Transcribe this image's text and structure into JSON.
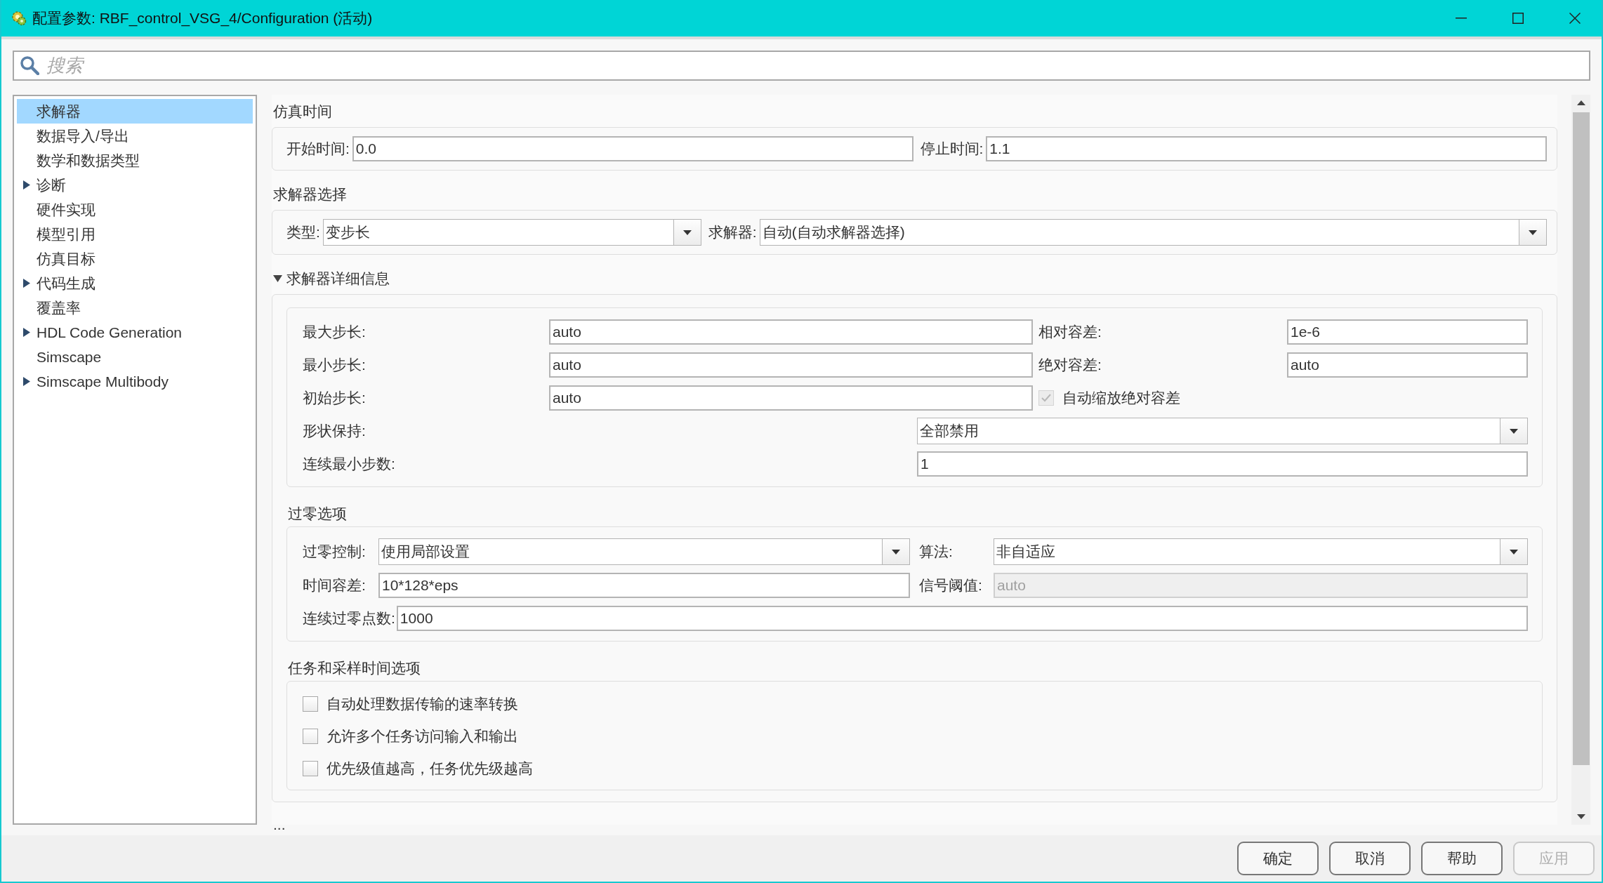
{
  "window": {
    "title": "配置参数: RBF_control_VSG_4/Configuration (活动)"
  },
  "search": {
    "placeholder": "搜索"
  },
  "sidebar": {
    "items": [
      {
        "label": "求解器",
        "selected": true,
        "expandable": false
      },
      {
        "label": "数据导入/导出",
        "selected": false,
        "expandable": false
      },
      {
        "label": "数学和数据类型",
        "selected": false,
        "expandable": false
      },
      {
        "label": "诊断",
        "selected": false,
        "expandable": true
      },
      {
        "label": "硬件实现",
        "selected": false,
        "expandable": false
      },
      {
        "label": "模型引用",
        "selected": false,
        "expandable": false
      },
      {
        "label": "仿真目标",
        "selected": false,
        "expandable": false
      },
      {
        "label": "代码生成",
        "selected": false,
        "expandable": true
      },
      {
        "label": "覆盖率",
        "selected": false,
        "expandable": false
      },
      {
        "label": "HDL Code Generation",
        "selected": false,
        "expandable": true
      },
      {
        "label": "Simscape",
        "selected": false,
        "expandable": false
      },
      {
        "label": "Simscape Multibody",
        "selected": false,
        "expandable": true
      }
    ]
  },
  "simulation_time": {
    "title": "仿真时间",
    "fields": [
      {
        "label": "开始时间:",
        "value": "0.0"
      },
      {
        "label": "停止时间:",
        "value": "1.1"
      }
    ]
  },
  "solver_selection": {
    "title": "求解器选择",
    "fields": [
      {
        "label": "类型:",
        "value": "变步长"
      },
      {
        "label": "求解器:",
        "value": "自动(自动求解器选择)"
      }
    ]
  },
  "solver_details": {
    "title": "求解器详细信息",
    "expanded": true,
    "rows": [
      {
        "left": {
          "label": "最大步长:",
          "value": "auto"
        },
        "right": {
          "kind": "text",
          "label": "相对容差:",
          "value": "1e-6"
        }
      },
      {
        "left": {
          "label": "最小步长:",
          "value": "auto"
        },
        "right": {
          "kind": "text",
          "label": "绝对容差:",
          "value": "auto"
        }
      },
      {
        "left": {
          "label": "初始步长:",
          "value": "auto"
        },
        "right": {
          "kind": "checkbox",
          "label": "自动缩放绝对容差",
          "checked": true,
          "disabled": true
        }
      }
    ],
    "wide_rows": [
      {
        "kind": "dropdown",
        "label": "形状保持:",
        "value": "全部禁用"
      },
      {
        "kind": "text",
        "label": "连续最小步数:",
        "value": "1"
      }
    ]
  },
  "zero_crossing": {
    "title": "过零选项",
    "fields": [
      {
        "kind": "dropdown",
        "label": "过零控制:",
        "value": "使用局部设置",
        "disabled": false
      },
      {
        "kind": "dropdown",
        "label": "算法:",
        "value": "非自适应",
        "disabled": false
      },
      {
        "kind": "text",
        "label": "时间容差:",
        "value": "10*128*eps",
        "disabled": false
      },
      {
        "kind": "text",
        "label": "信号阈值:",
        "value": "auto",
        "disabled": true
      }
    ],
    "count": {
      "label": "连续过零点数:",
      "value": "1000"
    }
  },
  "tasks": {
    "title": "任务和采样时间选项",
    "options": [
      {
        "label": "自动处理数据传输的速率转换",
        "checked": false
      },
      {
        "label": "允许多个任务访问输入和输出",
        "checked": false
      },
      {
        "label": "优先级值越高，任务优先级越高",
        "checked": false
      }
    ]
  },
  "more": "...",
  "buttons": [
    {
      "label": "确定",
      "disabled": false
    },
    {
      "label": "取消",
      "disabled": false
    },
    {
      "label": "帮助",
      "disabled": false
    },
    {
      "label": "应用",
      "disabled": true
    }
  ]
}
